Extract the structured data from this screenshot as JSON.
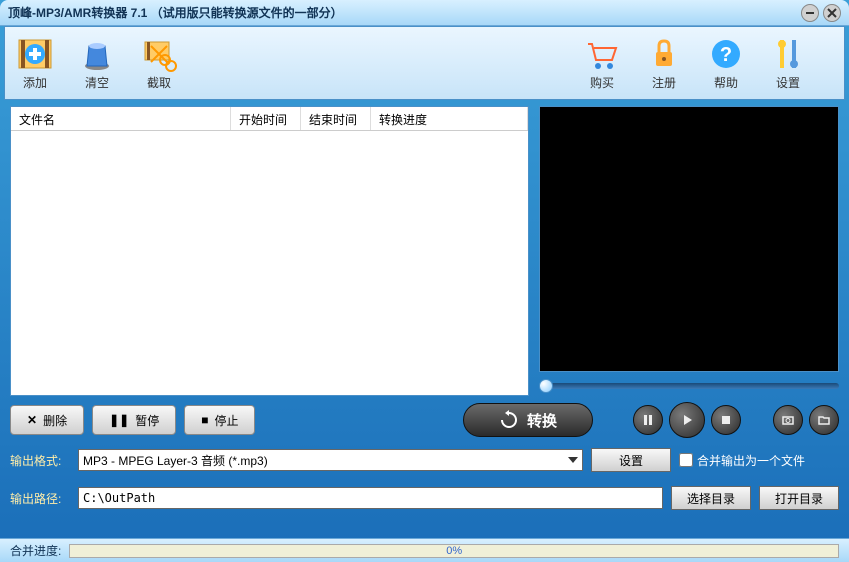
{
  "window": {
    "title": "顶峰-MP3/AMR转换器 7.1 （试用版只能转换源文件的一部分）"
  },
  "toolbar": {
    "add": "添加",
    "clear": "清空",
    "cut": "截取",
    "buy": "购买",
    "register": "注册",
    "help": "帮助",
    "settings": "设置"
  },
  "table": {
    "col_name": "文件名",
    "col_start": "开始时间",
    "col_end": "结束时间",
    "col_progress": "转换进度",
    "rows": []
  },
  "controls": {
    "delete": "删除",
    "pause": "暂停",
    "stop": "停止",
    "convert": "转换"
  },
  "output": {
    "format_label": "输出格式:",
    "format_value": "MP3 - MPEG Layer-3 音频 (*.mp3)",
    "settings_btn": "设置",
    "merge_check": "合并输出为一个文件",
    "path_label": "输出路径:",
    "path_value": "C:\\OutPath",
    "browse_btn": "选择目录",
    "open_btn": "打开目录"
  },
  "footer": {
    "label": "合并进度:",
    "percent": "0%"
  }
}
